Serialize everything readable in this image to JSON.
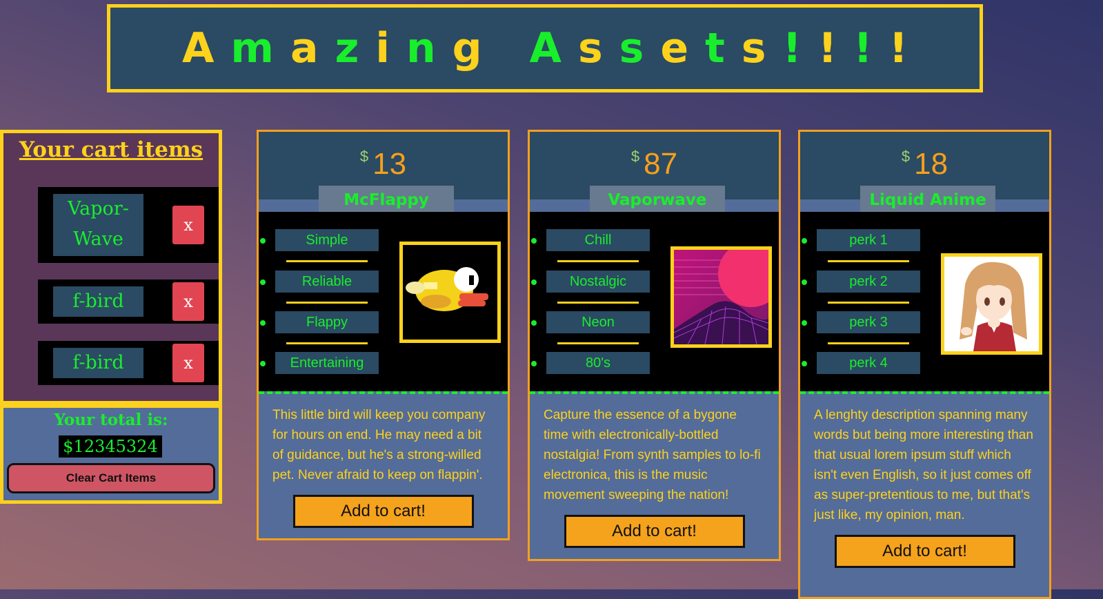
{
  "header": {
    "title_parts": [
      {
        "text": "Amazing",
        "color": "yellow-green"
      },
      {
        "text": "Assets!!!!",
        "color": "green-yellow"
      }
    ],
    "title": "Amazing Assets!!!!"
  },
  "cart": {
    "title": "Your cart items",
    "items": [
      {
        "name": "Vapor-Wave",
        "remove_label": "x"
      },
      {
        "name": "f-bird",
        "remove_label": "x"
      },
      {
        "name": "f-bird",
        "remove_label": "x"
      }
    ],
    "total_label": "Your total is:",
    "total_value": "$12345324",
    "clear_label": "Clear Cart Items"
  },
  "products": [
    {
      "currency": "$",
      "price": "13",
      "name": "McFlappy",
      "perks": [
        "Simple",
        "Reliable",
        "Flappy",
        "Entertaining"
      ],
      "image": "flappy-bird-icon",
      "description": "This little bird will keep you company for hours on end. He may need a bit of guidance, but he's a strong-willed pet. Never afraid to keep on flappin'.",
      "button_label": "Add to cart!"
    },
    {
      "currency": "$",
      "price": "87",
      "name": "Vaporwave",
      "perks": [
        "Chill",
        "Nostalgic",
        "Neon",
        "80's"
      ],
      "image": "vaporwave-landscape-image",
      "description": "Capture the essence of a bygone time with electronically-bottled nostalgia! From synth samples to lo-fi electronica, this is the music movement sweeping the nation!",
      "button_label": "Add to cart!"
    },
    {
      "currency": "$",
      "price": "18",
      "name": "Liquid Anime",
      "perks": [
        "perk 1",
        "perk 2",
        "perk 3",
        "perk 4"
      ],
      "image": "anime-girl-image",
      "description": "A lenghty description spanning many words but being more interesting than that usual lorem ipsum stuff which isn't even English, so it just comes off as super-pretentious to me, but that's just like, my opinion, man.",
      "button_label": "Add to cart!"
    }
  ],
  "colors": {
    "yellow": "#fdd21c",
    "green": "#19ee2c",
    "orange": "#f5a01c",
    "navy": "#2b4a63",
    "slate": "#546c9a",
    "red": "#e14552"
  }
}
